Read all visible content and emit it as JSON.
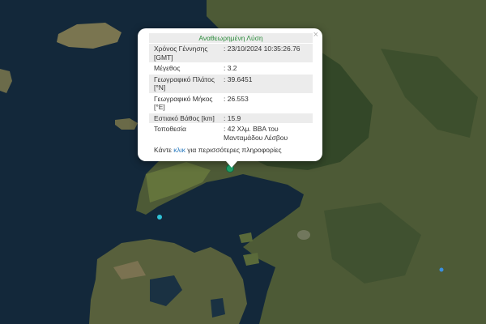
{
  "popup": {
    "title": "Αναθεωρημένη Λύση",
    "close_glyph": "×",
    "rows": [
      {
        "label": "Χρόνος Γέννησης [GMT]",
        "value": ": 23/10/2024 10:35:26.76"
      },
      {
        "label": "Μέγεθος",
        "value": ": 3.2"
      },
      {
        "label": "Γεωγραφικό Πλάτος [°N]",
        "value": ": 39.6451"
      },
      {
        "label": "Γεωγραφικό Μήκος [°E]",
        "value": ": 26.553"
      },
      {
        "label": "Εστιακό Βάθος [km]",
        "value": ": 15.9"
      },
      {
        "label": "Τοποθεσία",
        "value": ": 42 Χλμ. ΒΒΑ του Μανταμάδου Λέσβου"
      }
    ],
    "more_prefix": "Κάντε ",
    "more_link": "κλικ",
    "more_suffix": " για περισσότερες πληροφορίες"
  },
  "map": {
    "sea_color": "#13283a",
    "land_color": "#4d5a36",
    "mountain_color": "#2f4426",
    "markers": [
      {
        "type": "event",
        "color": "#1fa36a"
      },
      {
        "type": "event",
        "color": "#2fc3d8"
      },
      {
        "type": "event",
        "color": "#3a8fe0"
      }
    ]
  }
}
